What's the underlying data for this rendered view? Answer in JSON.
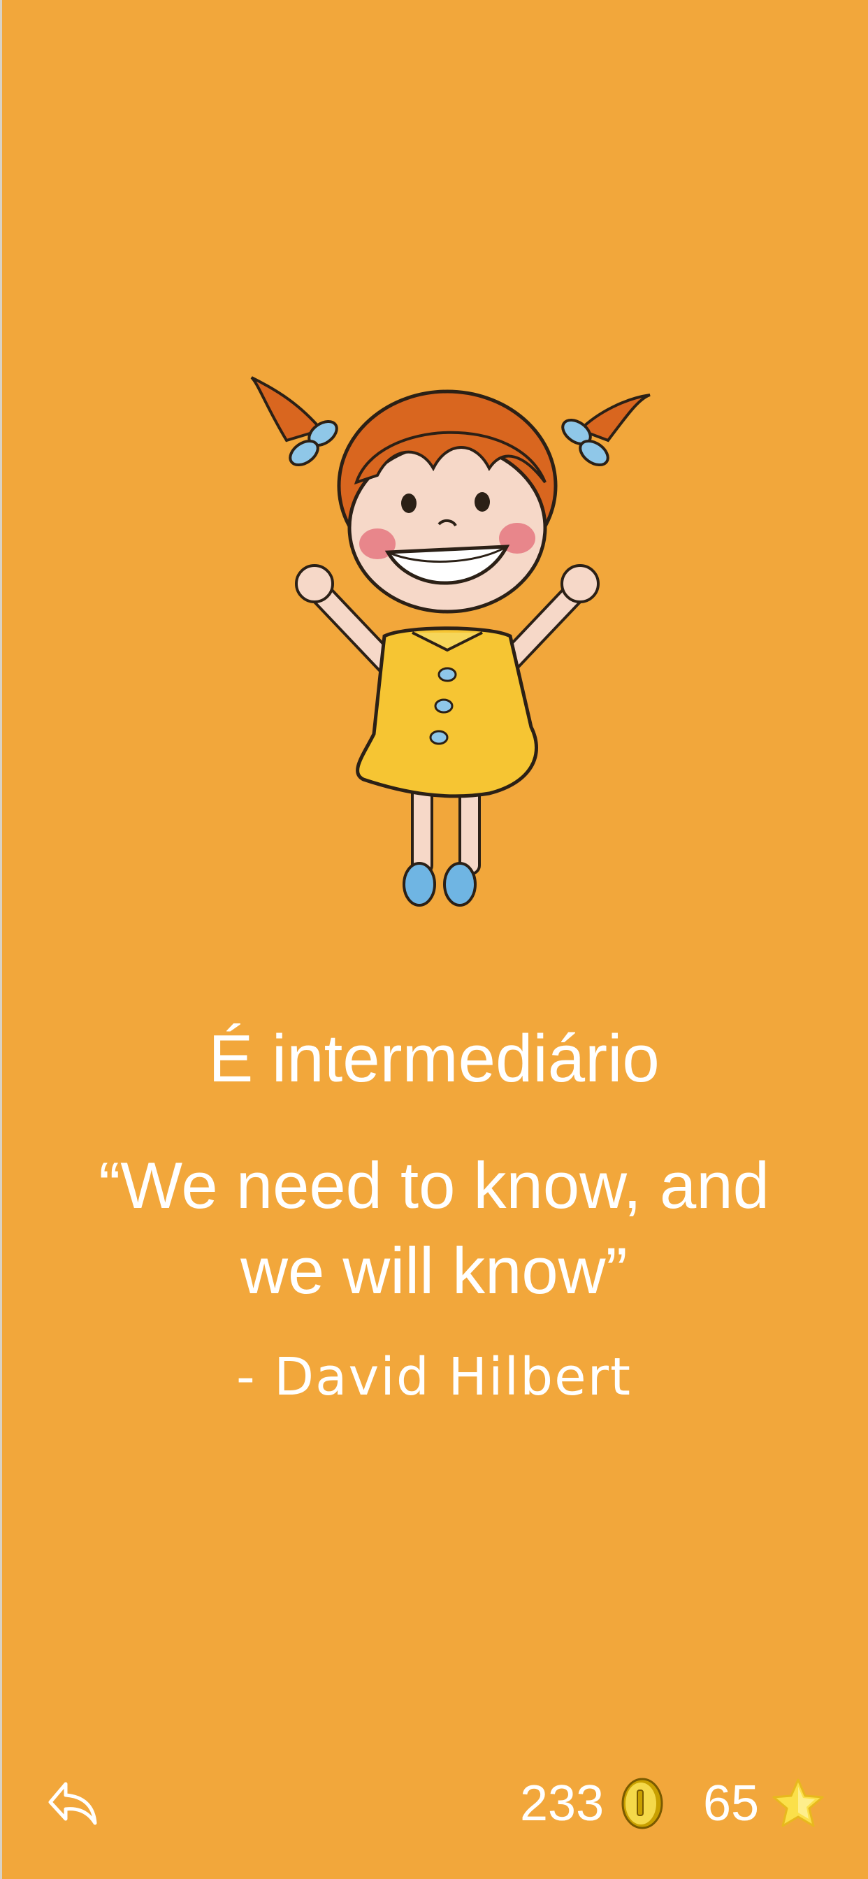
{
  "screen": {
    "background_color": "#F2A73B"
  },
  "illustration": {
    "icon": "happy-girl-jumping-illustration"
  },
  "level": {
    "title": "É intermediário"
  },
  "quote": {
    "text": "“We need to know, and we will know”",
    "author": "- David Hilbert"
  },
  "bottom_bar": {
    "share_icon": "share-arrow-icon",
    "coins": "233",
    "coin_icon": "coin-icon",
    "stars": "65",
    "star_icon": "star-icon"
  }
}
